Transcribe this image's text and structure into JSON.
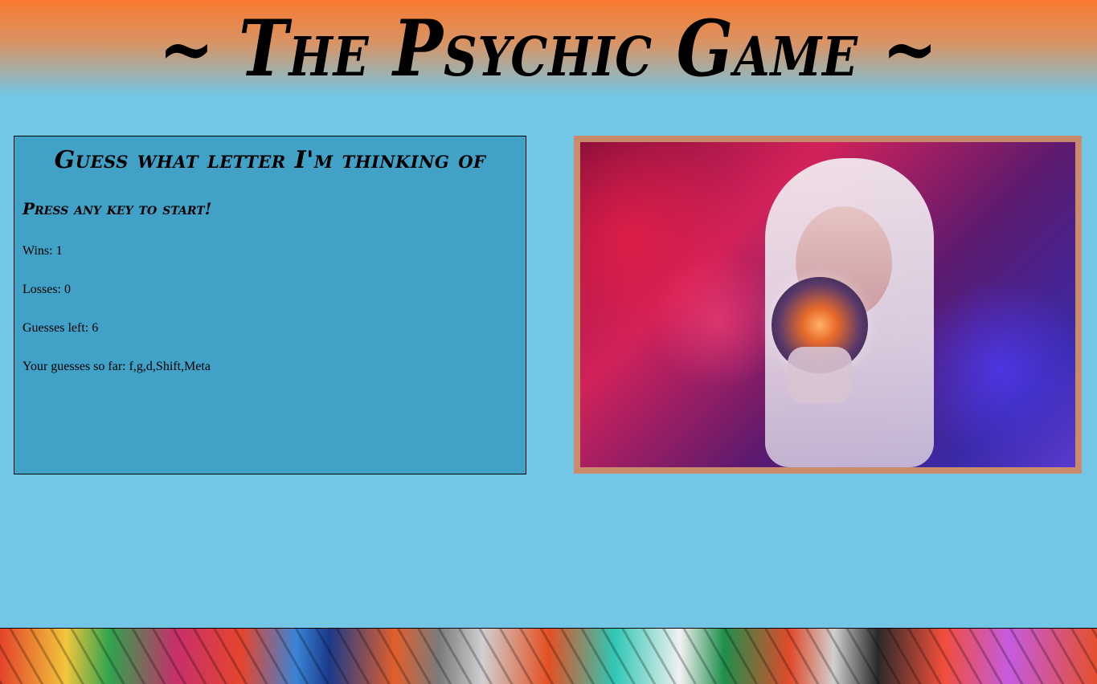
{
  "header": {
    "title": "~ The Psychic Game ~"
  },
  "game": {
    "heading": "Guess what letter I'm thinking of",
    "prompt": "Press any key to start!",
    "wins": "Wins: 1",
    "losses": "Losses: 0",
    "guesses_left": "Guesses left: 6",
    "guesses_so_far": "Your guesses so far: f,g,d,Shift,Meta"
  },
  "image": {
    "subject": "psychic-with-crystal-ball"
  },
  "colors": {
    "background": "#73c6e6",
    "header_orange": "#f97a30",
    "panel": "#42a1c6",
    "frame": "#c98b6b"
  }
}
